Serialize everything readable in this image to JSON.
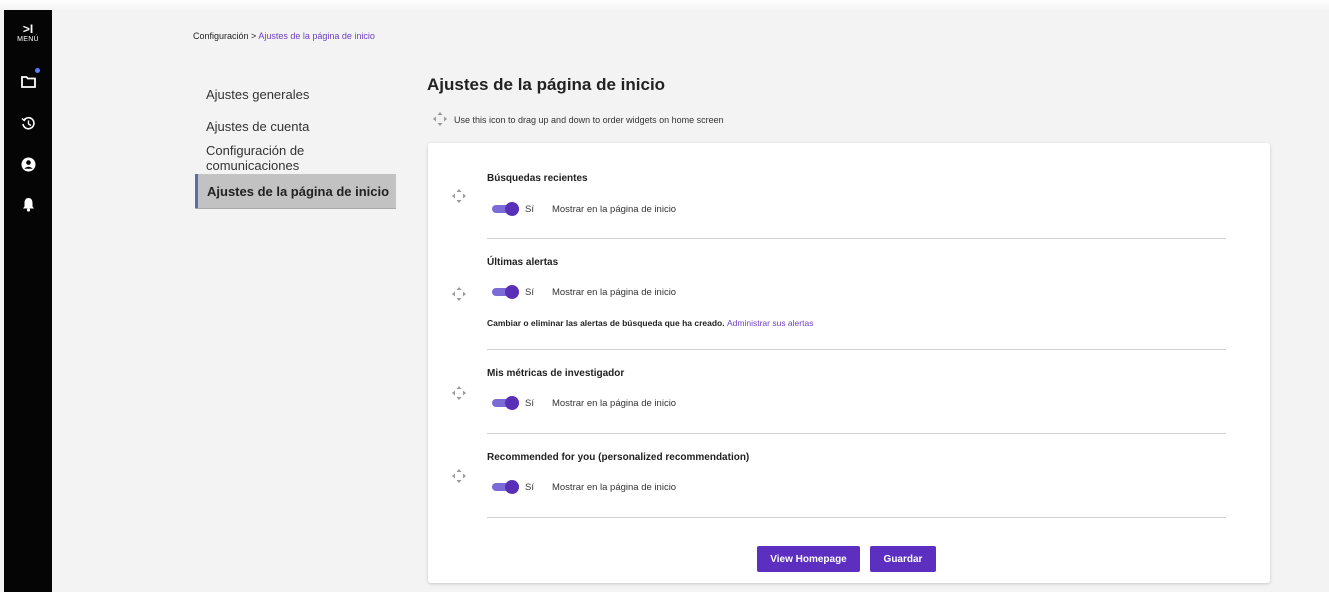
{
  "rail": {
    "menu_glyph": ">I",
    "menu_label": "MENÚ"
  },
  "breadcrumb": {
    "parent": "Configuración",
    "separator": " > ",
    "current": "Ajustes de la página de inicio"
  },
  "side_menu": {
    "items": [
      {
        "label": "Ajustes generales"
      },
      {
        "label": "Ajustes de cuenta"
      },
      {
        "label": "Configuración de comunicaciones"
      },
      {
        "label": "Ajustes de la página de inicio",
        "active": true
      }
    ]
  },
  "main": {
    "title": "Ajustes de la página de inicio",
    "hint": "Use this icon to drag up and down to order widgets on home screen",
    "widgets": [
      {
        "title": "Búsquedas recientes",
        "toggle_on": true,
        "toggle_label": "Sí",
        "show_text": "Mostrar en la página de inicio"
      },
      {
        "title": "Últimas alertas",
        "toggle_on": true,
        "toggle_label": "Sí",
        "show_text": "Mostrar en la página de inicio",
        "note": "Cambiar o eliminar las alertas de búsqueda que ha creado.",
        "note_link": "Administrar sus alertas"
      },
      {
        "title": "Mis métricas de investigador",
        "toggle_on": true,
        "toggle_label": "Sí",
        "show_text": "Mostrar en la página de inicio"
      },
      {
        "title": "Recommended for you (personalized recommendation)",
        "toggle_on": true,
        "toggle_label": "Sí",
        "show_text": "Mostrar en la página de inicio"
      }
    ],
    "buttons": {
      "view_homepage": "View Homepage",
      "save": "Guardar"
    }
  },
  "colors": {
    "accent": "#5d2fc0",
    "link": "#6f3fc6",
    "rail": "#050505",
    "notification_dot": "#5b7bff"
  },
  "icons": [
    "menu-expand-icon",
    "folder-icon",
    "history-icon",
    "user-circle-icon",
    "bell-icon",
    "drag-handle-icon"
  ]
}
